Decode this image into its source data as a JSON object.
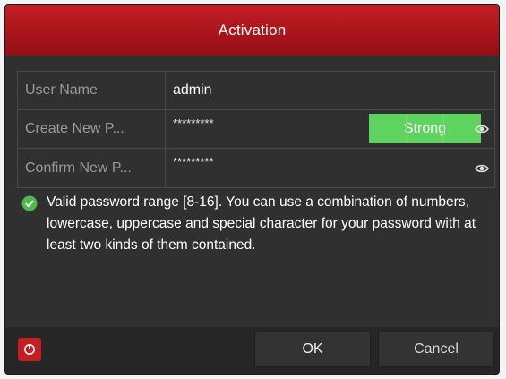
{
  "dialog": {
    "title": "Activation"
  },
  "form": {
    "username": {
      "label": "User Name",
      "value": "admin"
    },
    "new_password": {
      "label": "Create New P...",
      "value": "*********",
      "strength": "Strong"
    },
    "confirm_password": {
      "label": "Confirm New P...",
      "value": "*********"
    }
  },
  "hint": {
    "text": "Valid password range [8-16]. You can use a combination of numbers, lowercase, uppercase and special character for your password with at least two kinds of them contained."
  },
  "footer": {
    "ok_label": "OK",
    "cancel_label": "Cancel"
  },
  "icons": {
    "eye": "eye-icon",
    "check": "check-circle-icon",
    "power": "power-icon"
  },
  "colors": {
    "title_bar": "#b0171c",
    "strength_strong": "#5fd35f",
    "check": "#4cbb4c",
    "power_button": "#c41d22"
  }
}
